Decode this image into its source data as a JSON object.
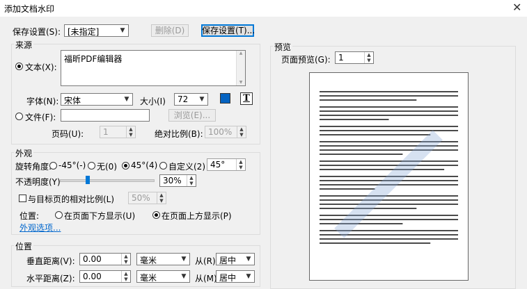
{
  "window": {
    "title": "添加文档水印",
    "close_glyph": "✕"
  },
  "save_settings": {
    "label": "保存设置(S):",
    "value": "[未指定]",
    "delete_label": "删除(D)",
    "save_label": "保存设置(T)..."
  },
  "source": {
    "title": "来源",
    "text_radio": "文本(X):",
    "text_value": "福昕PDF编辑器",
    "font_label": "字体(N):",
    "font_value": "宋体",
    "size_label": "大小(I)",
    "size_value": "72",
    "color": "#0563c1",
    "underline_btn": "T",
    "file_radio": "文件(F):",
    "file_value": "",
    "browse_label": "浏览(E)...",
    "page_label": "页码(U):",
    "page_value": "1",
    "scale_label": "绝对比例(B):",
    "scale_value": "100%"
  },
  "appearance": {
    "title": "外观",
    "rotation_label": "旋转角度:",
    "rot_m45": "-45°(-)",
    "rot_none": "无(0)",
    "rot_45": "45°(4)",
    "rot_custom": "自定义(2)",
    "rot_custom_value": "45°",
    "opacity_label": "不透明度(Y)",
    "opacity_value": "30%",
    "opacity_level": 0.3,
    "relative_scale_label": "与目标页的相对比例(L)",
    "relative_scale_value": "50%",
    "position_label": "位置:",
    "pos_below": "在页面下方显示(U)",
    "pos_above": "在页面上方显示(P)",
    "more_link": "外观选项..."
  },
  "position": {
    "title": "位置",
    "vertical_label": "垂直距离(V):",
    "vertical_value": "0.00",
    "vertical_unit": "毫米",
    "vertical_from": "从(R)",
    "vertical_from_value": "居中",
    "horizontal_label": "水平距离(Z):",
    "horizontal_value": "0.00",
    "horizontal_unit": "毫米",
    "horizontal_from": "从(M)",
    "horizontal_from_value": "居中"
  },
  "preview": {
    "title": "预览",
    "page_label": "页面预览(G):",
    "page_value": "1"
  }
}
